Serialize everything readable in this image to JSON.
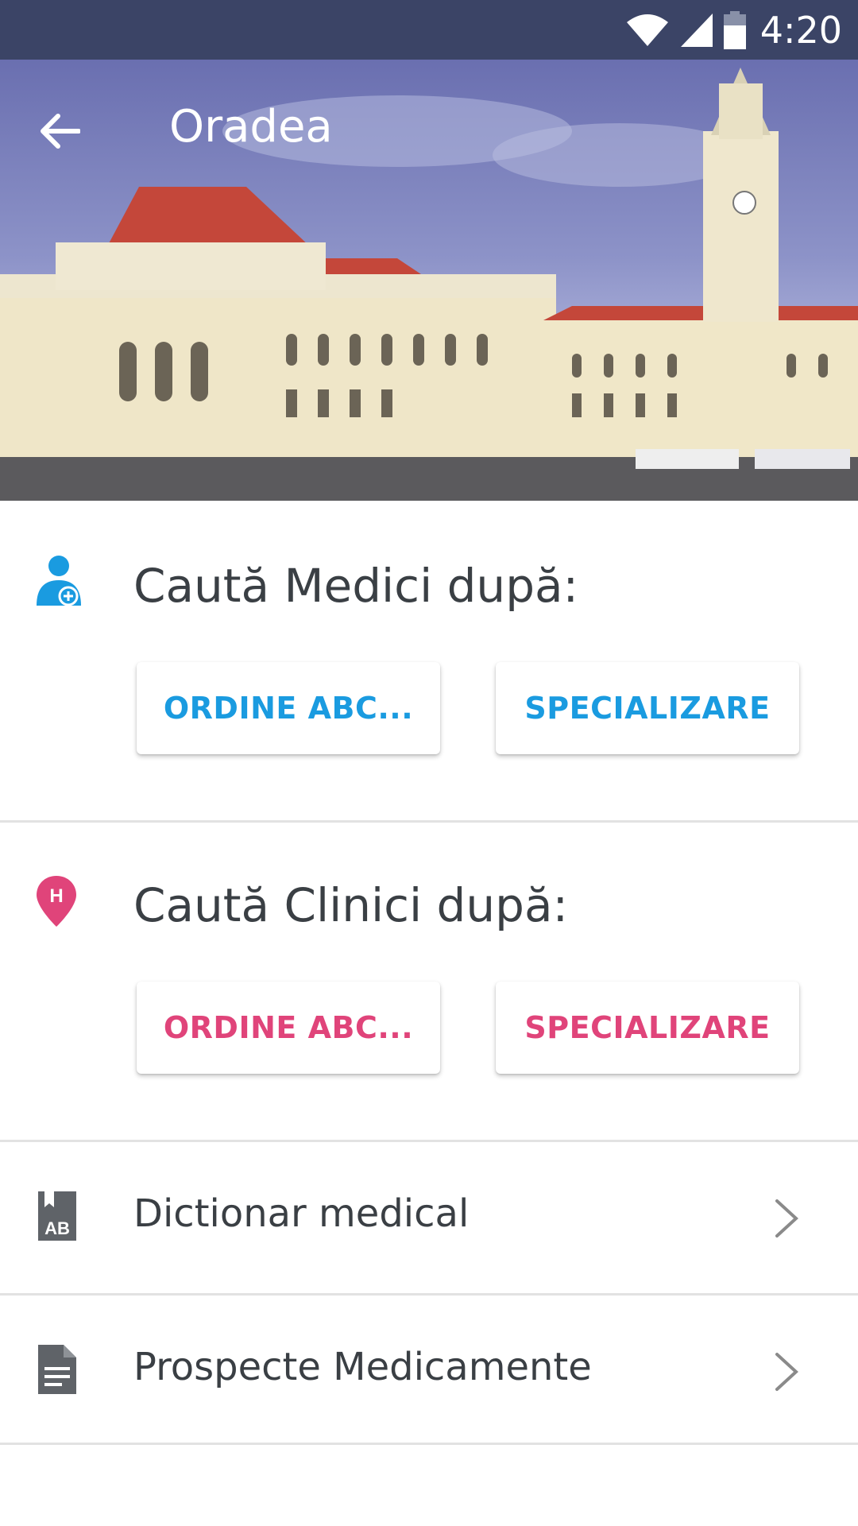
{
  "status_bar": {
    "time": "4:20",
    "icons": [
      "wifi-icon",
      "signal-icon",
      "battery-icon"
    ]
  },
  "app_bar": {
    "title": "Oradea",
    "back_icon": "arrow-back-icon"
  },
  "doctors": {
    "icon": "doctor-add-icon",
    "title": "Caută Medici după:",
    "buttons": {
      "alphabetical": "ORDINE ABC...",
      "specialty": "SPECIALIZARE"
    }
  },
  "clinics": {
    "icon": "hospital-pin-icon",
    "icon_letter": "H",
    "title": "Caută Clinici după:",
    "buttons": {
      "alphabetical": "ORDINE ABC...",
      "specialty": "SPECIALIZARE"
    }
  },
  "list": [
    {
      "label": "Dictionar medical",
      "icon": "dictionary-icon",
      "icon_text": "AB"
    },
    {
      "label": "Prospecte Medicamente",
      "icon": "document-icon"
    }
  ],
  "colors": {
    "status_bar": "#3b4466",
    "blue_accent": "#1a9be0",
    "pink_accent": "#e0447a",
    "text": "#3a3f44",
    "icon_gray": "#5f6368"
  }
}
